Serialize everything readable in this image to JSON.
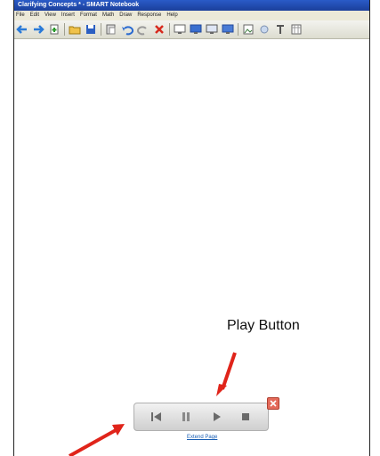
{
  "window": {
    "title": "Clarifying Concepts * - SMART Notebook"
  },
  "menu": [
    "File",
    "Edit",
    "View",
    "Insert",
    "Format",
    "Math",
    "Draw",
    "Response",
    "Help"
  ],
  "annotation": {
    "play_label": "Play Button"
  },
  "player": {
    "close_icon": "close-icon",
    "extend_link": "Extend Page"
  },
  "colors": {
    "titlebar": "#1b3f9b",
    "arrow": "#e0241a",
    "close": "#e46a5a"
  }
}
